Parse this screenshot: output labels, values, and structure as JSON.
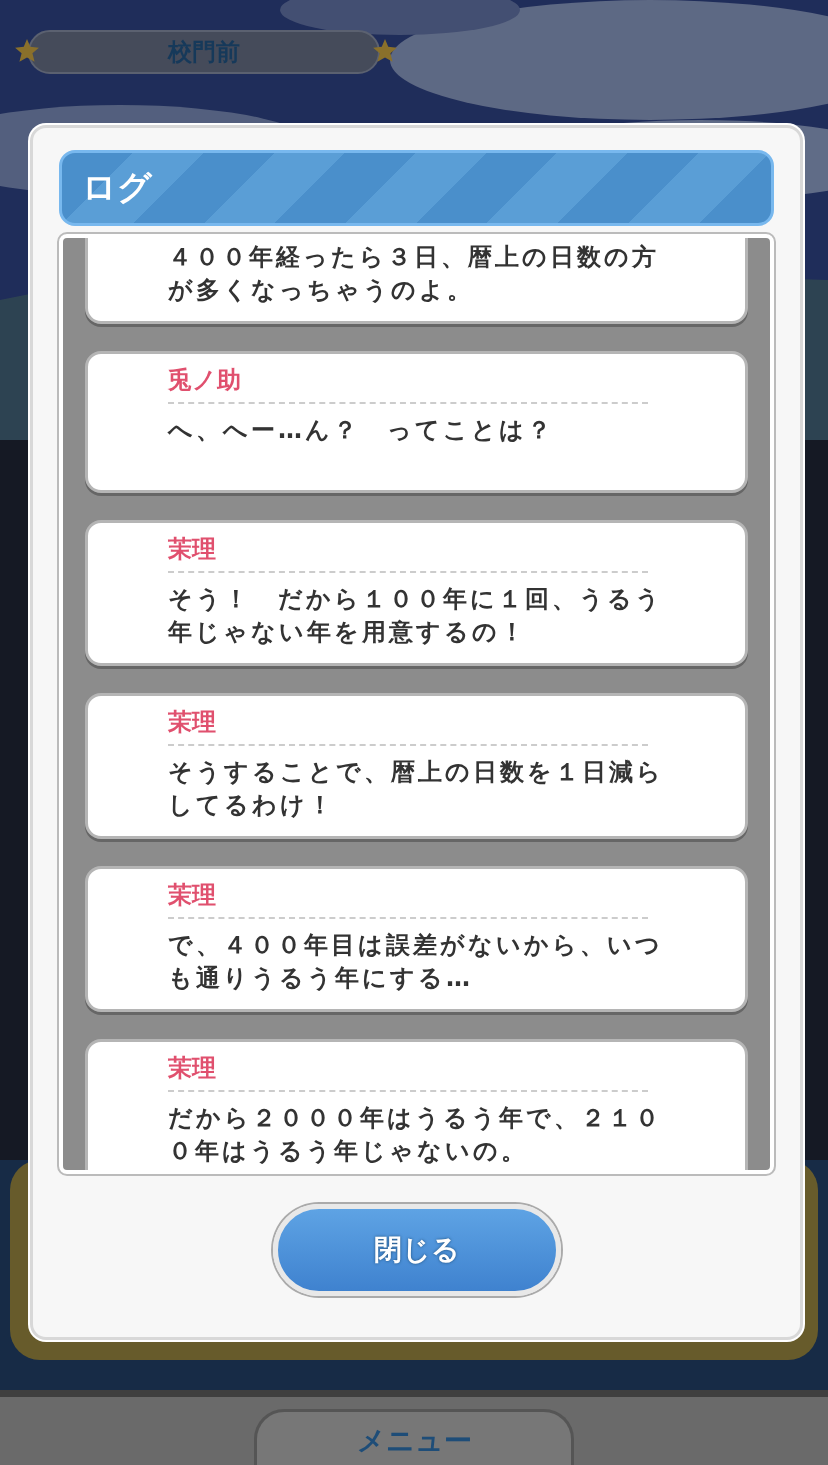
{
  "location": {
    "label": "校門前"
  },
  "dialog": {
    "title": "ログ",
    "entries": [
      {
        "text": "４００年経ったら３日、暦上の日数の方が多くなっちゃうのよ。"
      },
      {
        "speaker": "兎ノ助",
        "text": "へ、へー…ん？　ってことは？"
      },
      {
        "speaker": "茉理",
        "text": "そう！　だから１００年に１回、うるう年じゃない年を用意するの！"
      },
      {
        "speaker": "茉理",
        "text": "そうすることで、暦上の日数を１日減らしてるわけ！"
      },
      {
        "speaker": "茉理",
        "text": "で、４００年目は誤差がないから、いつも通りうるう年にする…"
      },
      {
        "speaker": "茉理",
        "text": "だから２０００年はうるう年で、２１００年はうるう年じゃないの。"
      }
    ],
    "close_button": "閉じる"
  },
  "menu_button": "メニュー"
}
